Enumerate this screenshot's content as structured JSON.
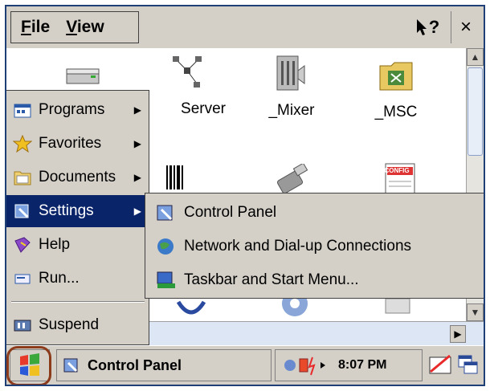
{
  "menubar": {
    "file": "File",
    "file_u": "F",
    "file_rest": "ile",
    "view": "View",
    "view_u": "V",
    "view_rest": "iew",
    "help_glyph": "?",
    "close_glyph": "×"
  },
  "desktop": {
    "icons": [
      {
        "label": ""
      },
      {
        "label": "Server"
      },
      {
        "label": "_Mixer"
      },
      {
        "label": "_MSC"
      }
    ],
    "config_label": "CONFIG"
  },
  "start_menu": {
    "items": [
      {
        "label": "Programs",
        "icon": "programs-icon"
      },
      {
        "label": "Favorites",
        "icon": "favorites-icon"
      },
      {
        "label": "Documents",
        "icon": "documents-icon"
      },
      {
        "label": "Settings",
        "icon": "settings-icon"
      },
      {
        "label": "Help",
        "icon": "help-icon"
      },
      {
        "label": "Run...",
        "icon": "run-icon"
      },
      {
        "label": "Suspend",
        "icon": "suspend-icon"
      }
    ]
  },
  "settings_submenu": {
    "items": [
      {
        "label": "Control Panel",
        "icon": "control-panel-icon"
      },
      {
        "label": "Network and Dial-up Connections",
        "icon": "network-icon"
      },
      {
        "label": "Taskbar and Start Menu...",
        "icon": "taskbar-icon"
      }
    ]
  },
  "taskbar": {
    "task_label": "Control Panel",
    "clock": "8:07 PM"
  },
  "colors": {
    "highlight": "#0a246a",
    "chrome": "#d4d0c8",
    "start_outline": "#8b3a1a"
  }
}
